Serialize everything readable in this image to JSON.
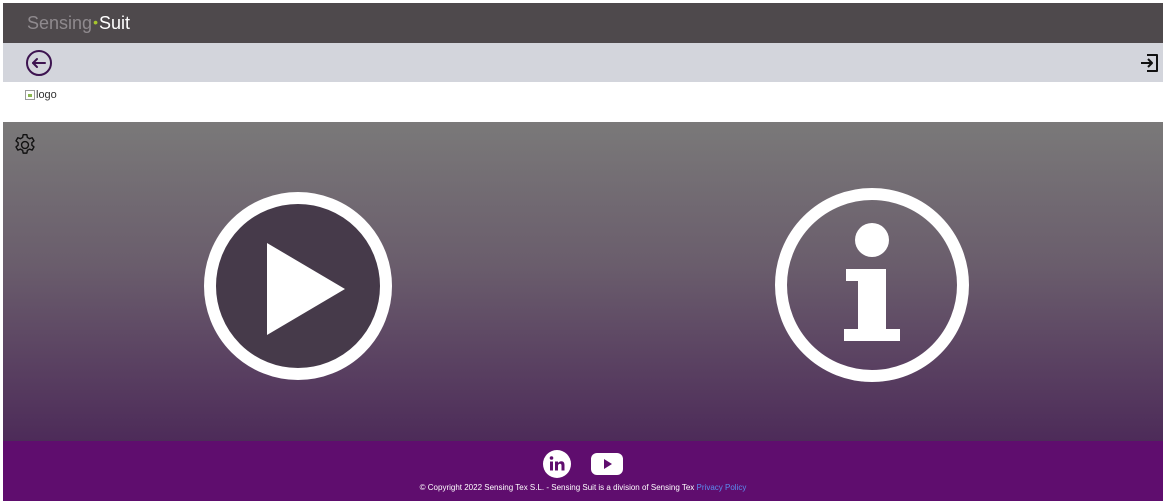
{
  "header": {
    "brand_part1": "Sensing",
    "brand_dot": "•",
    "brand_part2": "Suit"
  },
  "nav": {
    "back_icon": "arrow-left-circle-icon",
    "logout_icon": "logout-icon"
  },
  "logo": {
    "alt": "logo"
  },
  "main": {
    "settings_icon": "gear-icon",
    "play_icon": "play-circle-icon",
    "info_icon": "info-circle-icon"
  },
  "footer": {
    "linkedin_icon": "linkedin-icon",
    "youtube_icon": "youtube-icon",
    "copyright": "© Copyright 2022 Sensing Tex S.L. - Sensing Suit is a division of Sensing Tex",
    "privacy_link": "Privacy Policy"
  },
  "colors": {
    "topbar": "#4e494c",
    "navbar": "#d3d5dc",
    "brand_dot": "#a6c62c",
    "gradient_top": "#7a7979",
    "gradient_bottom": "#4d2b59",
    "footer": "#5f0d6e",
    "link": "#5b8df0"
  }
}
